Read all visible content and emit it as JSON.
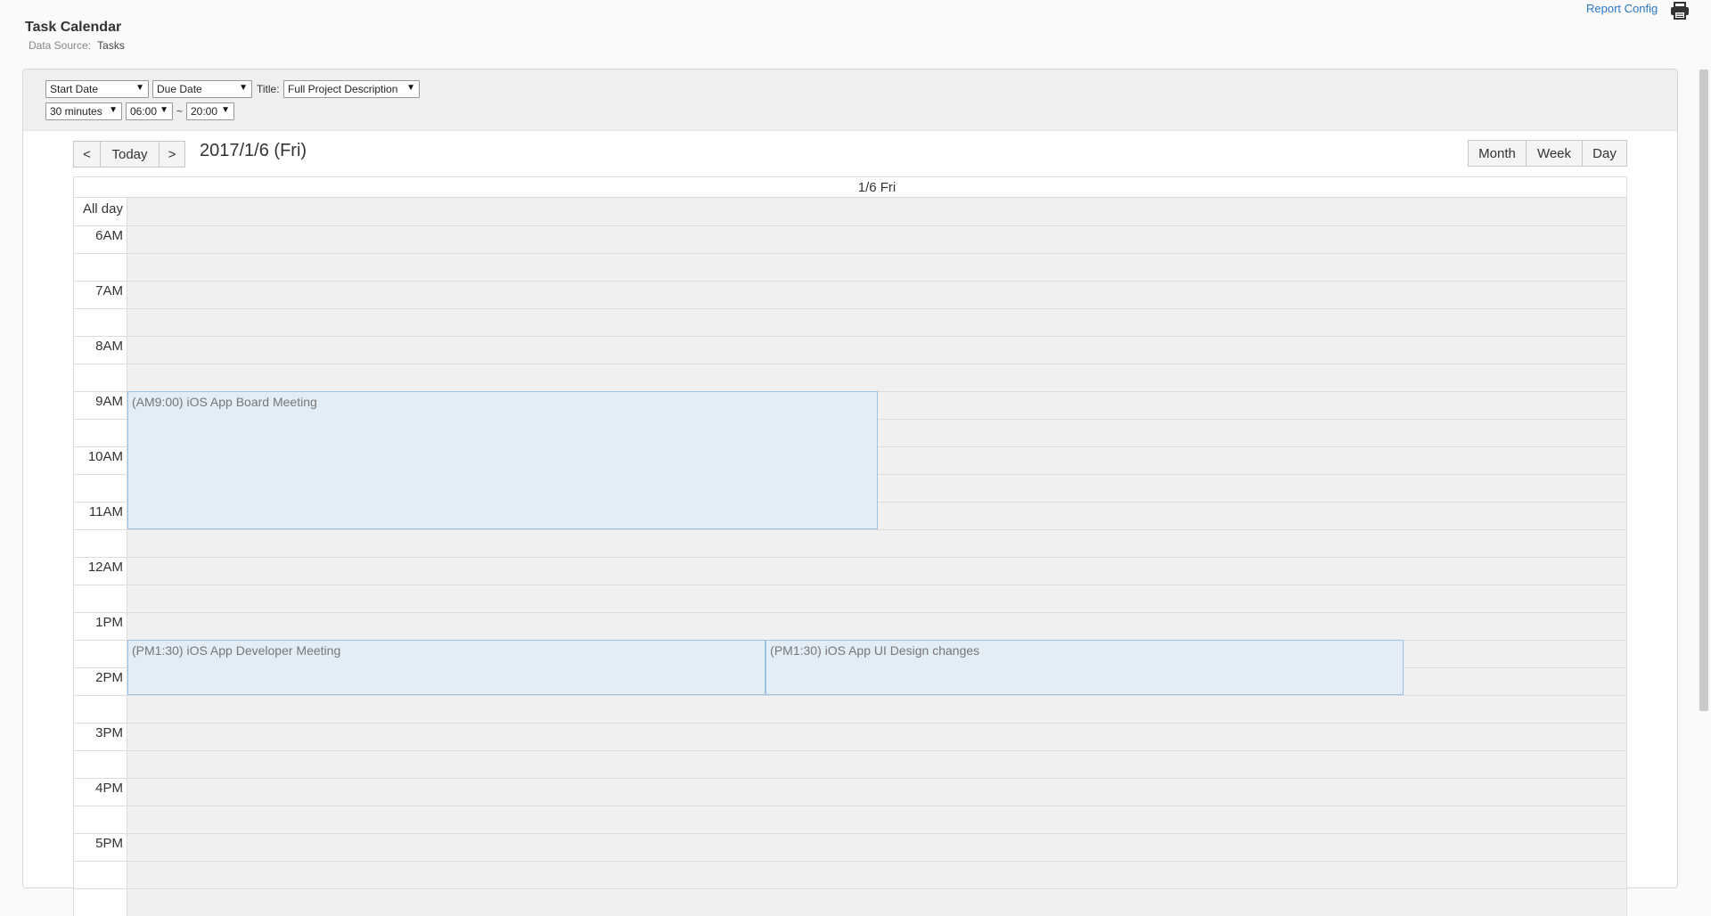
{
  "header": {
    "title": "Task Calendar",
    "data_source_label": "Data Source:",
    "data_source_value": "Tasks",
    "report_config": "Report Config",
    "print_icon": "printer-icon"
  },
  "filters": {
    "start_field": "Start Date",
    "due_field": "Due Date",
    "title_label": "Title:",
    "title_field": "Full Project Description",
    "interval": "30 minutes",
    "from_time": "06:00",
    "range_sep": "~",
    "to_time": "20:00"
  },
  "toolbar": {
    "prev": "<",
    "today": "Today",
    "next": ">",
    "current_date": "2017/1/6 (Fri)",
    "views": [
      "Month",
      "Week",
      "Day"
    ]
  },
  "day_view": {
    "column_header": "1/6 Fri",
    "all_day_label": "All day",
    "hours": [
      "6AM",
      "7AM",
      "8AM",
      "9AM",
      "10AM",
      "11AM",
      "12AM",
      "1PM",
      "2PM",
      "3PM",
      "4PM",
      "5PM"
    ],
    "events": [
      {
        "label": "(AM9:00) iOS App Board Meeting",
        "start": "09:00",
        "end": "11:30",
        "col": 0,
        "ncols": 2
      },
      {
        "label": "(PM1:30) iOS App Developer Meeting",
        "start": "13:30",
        "end": "14:30",
        "col": 0,
        "ncols": 2.35
      },
      {
        "label": "(PM1:30) iOS App UI Design changes",
        "start": "13:30",
        "end": "14:30",
        "col": 1,
        "ncols": 2.35
      }
    ]
  },
  "colors": {
    "event_bg": "#e3edf6",
    "event_border": "#9cc3e6",
    "link": "#2a78c6",
    "slot_bg": "#f0f0f0"
  }
}
